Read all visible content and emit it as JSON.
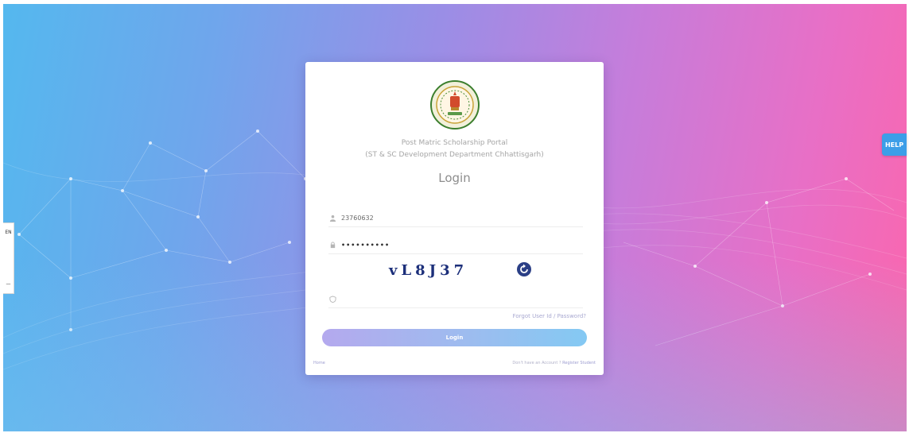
{
  "left_tab": {
    "top_label": "EN",
    "bottom_label": "—"
  },
  "help_button": {
    "label": "HELP"
  },
  "portal": {
    "line1": "Post Matric Scholarship Portal",
    "line2": "(ST & SC Development Department Chhattisgarh)"
  },
  "login": {
    "title": "Login",
    "user_icon": "user-icon",
    "username_value": "23760632",
    "password_icon": "lock-icon",
    "password_value": "••••••••••",
    "captcha_text": "vL8J37",
    "refresh_icon": "refresh-icon",
    "captcha_input_icon": "shield-icon",
    "captcha_input_value": "",
    "forgot_label": "Forgot User Id / Password?",
    "button_label": "Login",
    "home_label": "Home",
    "no_account_label": "Don't have an Account ?",
    "register_label": "Register Student"
  },
  "colors": {
    "gradient_left": "#54b8ee",
    "gradient_right": "#fb66ad",
    "help_blue": "#3c9ee8",
    "captcha_text": "#1c2f7a"
  }
}
